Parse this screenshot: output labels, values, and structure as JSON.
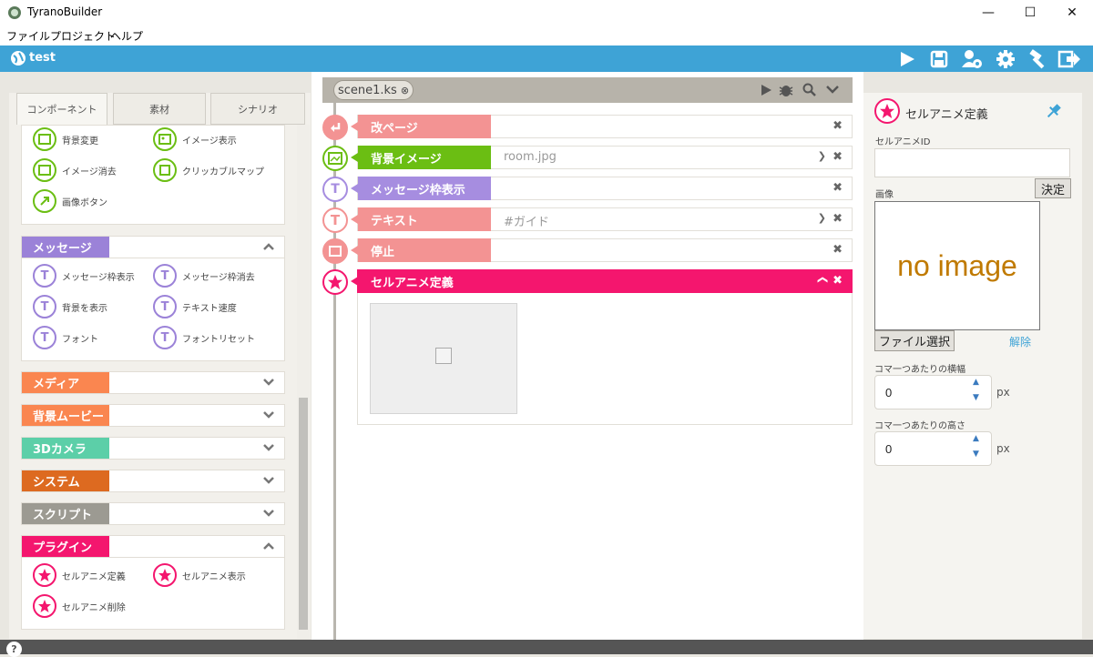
{
  "window": {
    "title": "TyranoBuilder",
    "minimize": "—",
    "maximize": "☐",
    "close": "✕"
  },
  "menu": [
    "ファイル",
    "プロジェクト",
    "ヘルプ"
  ],
  "toolbar": {
    "project_name": "test",
    "icons": [
      "play-icon",
      "save-icon",
      "user-settings-icon",
      "gear-icon",
      "hammer-icon",
      "exit-icon"
    ]
  },
  "left_panel": {
    "tabs": [
      "コンポーネント",
      "素材",
      "シナリオ"
    ],
    "active_tab": "コンポーネント",
    "image_components": [
      "背景変更",
      "イメージ表示",
      "イメージ消去",
      "クリッカブルマップ",
      "画像ボタン"
    ],
    "categories": [
      {
        "label": "メッセージ",
        "color": "#9b82d8",
        "expanded": true,
        "items": [
          "メッセージ枠表示",
          "メッセージ枠消去",
          "背景を表示",
          "テキスト速度",
          "フォント",
          "フォントリセット"
        ]
      },
      {
        "label": "メディア",
        "color": "#fa8650",
        "expanded": false
      },
      {
        "label": "背景ムービー",
        "color": "#fa8650",
        "expanded": false
      },
      {
        "label": "3Dカメラ",
        "color": "#5ccfa8",
        "expanded": false
      },
      {
        "label": "システム",
        "color": "#dd6a20",
        "expanded": false
      },
      {
        "label": "スクリプト",
        "color": "#9c9a92",
        "expanded": false
      },
      {
        "label": "プラグイン",
        "color": "#f4166e",
        "expanded": true,
        "items": [
          "セルアニメ定義",
          "セルアニメ表示",
          "セルアニメ削除"
        ]
      }
    ]
  },
  "scene": {
    "tab_label": "scene1.ks",
    "rows": [
      {
        "label": "改ページ",
        "value": "",
        "color": "#f39393",
        "icon": "page-break-icon"
      },
      {
        "label": "背景イメージ",
        "value": "room.jpg",
        "color": "#6bbe13",
        "icon": "background-icon"
      },
      {
        "label": "メッセージ枠表示",
        "value": "",
        "color": "#a68de0",
        "icon": "message-window-icon"
      },
      {
        "label": "テキスト",
        "value": "#ガイド",
        "color": "#f39393",
        "icon": "text-icon"
      },
      {
        "label": "停止",
        "value": "",
        "color": "#f39393",
        "icon": "stop-icon"
      },
      {
        "label": "セルアニメ定義",
        "value": "",
        "color": "#f4166e",
        "icon": "star-icon"
      }
    ]
  },
  "right_panel": {
    "title": "セルアニメ定義",
    "id_label": "セルアニメID",
    "id_value": "",
    "decide_button": "決定",
    "image_label": "画像",
    "no_image_text": "no image",
    "file_select_button": "ファイル選択",
    "clear_link": "解除",
    "frame_width_label": "コマ一つあたりの横幅",
    "frame_width_value": "0",
    "frame_height_label": "コマ一つあたりの高さ",
    "frame_height_value": "0",
    "unit": "px"
  },
  "help": "?"
}
